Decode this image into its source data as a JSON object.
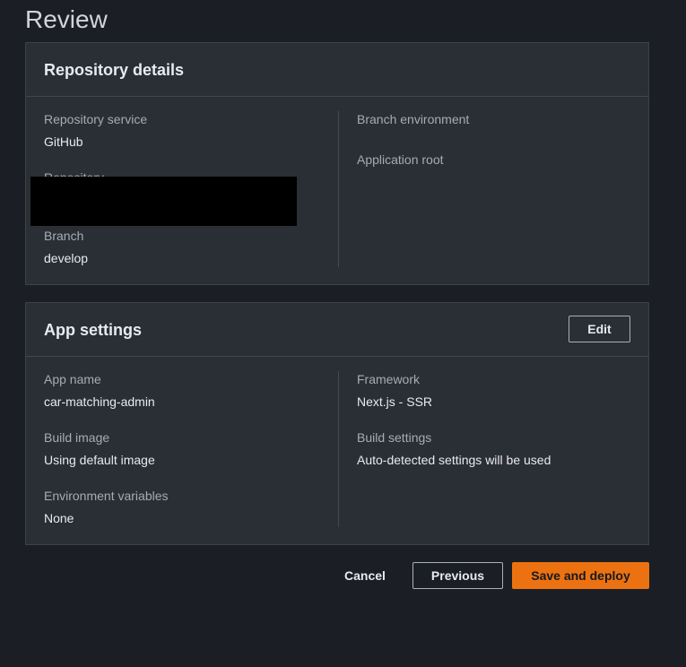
{
  "page": {
    "title": "Review"
  },
  "repository_details": {
    "title": "Repository details",
    "left_fields": [
      {
        "label": "Repository service",
        "value": "GitHub"
      },
      {
        "label": "Repository",
        "value": ""
      },
      {
        "label": "Branch",
        "value": "develop"
      }
    ],
    "right_fields": [
      {
        "label": "Branch environment",
        "value": ""
      },
      {
        "label": "Application root",
        "value": ""
      }
    ]
  },
  "app_settings": {
    "title": "App settings",
    "edit_label": "Edit",
    "left_fields": [
      {
        "label": "App name",
        "value": "car-matching-admin"
      },
      {
        "label": "Build image",
        "value": "Using default image"
      },
      {
        "label": "Environment variables",
        "value": "None"
      }
    ],
    "right_fields": [
      {
        "label": "Framework",
        "value": "Next.js - SSR"
      },
      {
        "label": "Build settings",
        "value": "Auto-detected settings will be used"
      }
    ]
  },
  "actions": {
    "cancel_label": "Cancel",
    "previous_label": "Previous",
    "deploy_label": "Save and deploy"
  },
  "colors": {
    "background": "#1b1e25",
    "panel": "#2a2e35",
    "primary_button": "#ec7211"
  }
}
